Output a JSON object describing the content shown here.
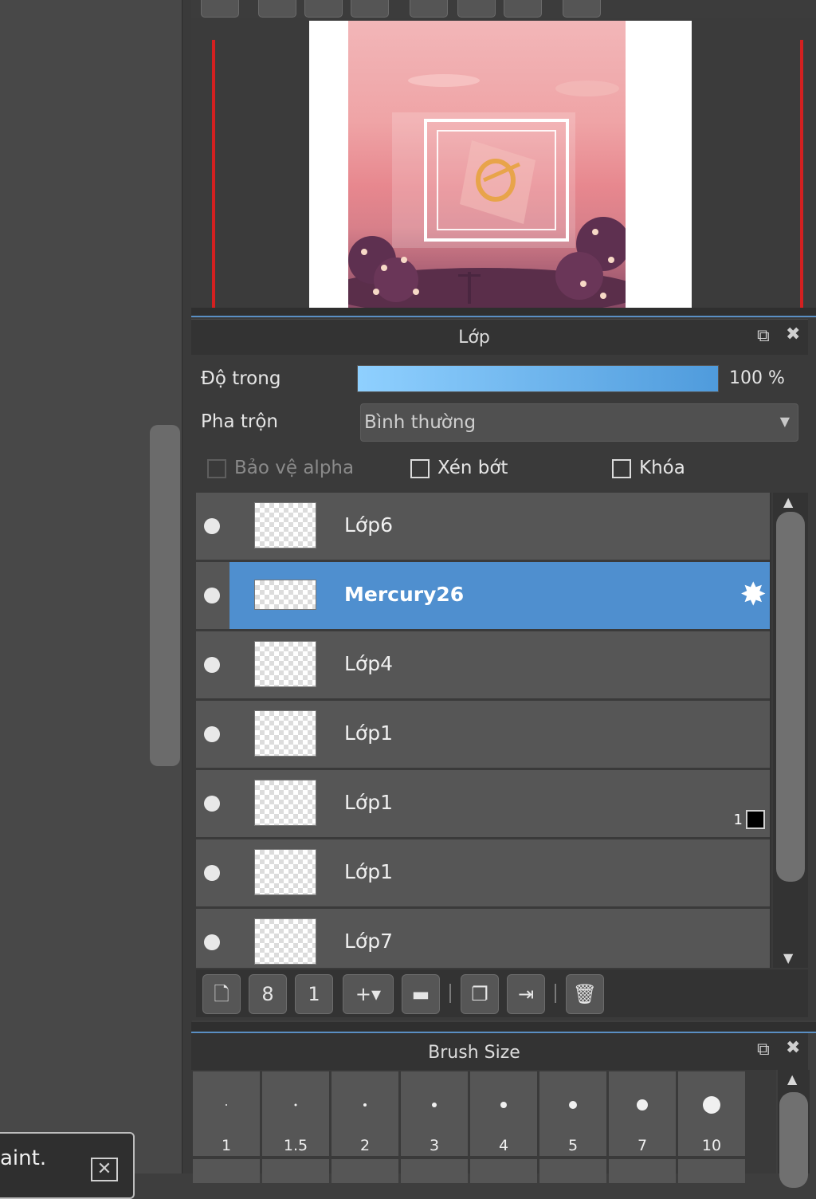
{
  "layer_panel": {
    "title": "Lớp",
    "opacity_label": "Độ trong",
    "opacity_value_text": "100 %",
    "opacity_percent": 100,
    "blend_label": "Pha trộn",
    "blend_value": "Bình thường",
    "checkboxes": {
      "alpha_protect": "Bảo vệ alpha",
      "clipping": "Xén bớt",
      "lock": "Khóa"
    },
    "layers": [
      {
        "name": "Lớp6",
        "selected": false
      },
      {
        "name": "Mercury26",
        "selected": true
      },
      {
        "name": "Lớp4",
        "selected": false
      },
      {
        "name": "Lớp1",
        "selected": false
      },
      {
        "name": "Lớp1",
        "selected": false,
        "clip_count": "1"
      },
      {
        "name": "Lớp1",
        "selected": false
      },
      {
        "name": "Lớp7",
        "selected": false
      }
    ]
  },
  "brush_panel": {
    "title": "Brush Size",
    "sizes": [
      "1",
      "1.5",
      "2",
      "3",
      "4",
      "5",
      "7",
      "10"
    ]
  },
  "notification": {
    "text": "aint."
  },
  "colors": {
    "selection": "#4f8fcf",
    "panel_bg": "#3a3a3a",
    "row_bg": "#565656",
    "accent_line": "#5a8fc4",
    "canvas_border": "#d42020"
  }
}
